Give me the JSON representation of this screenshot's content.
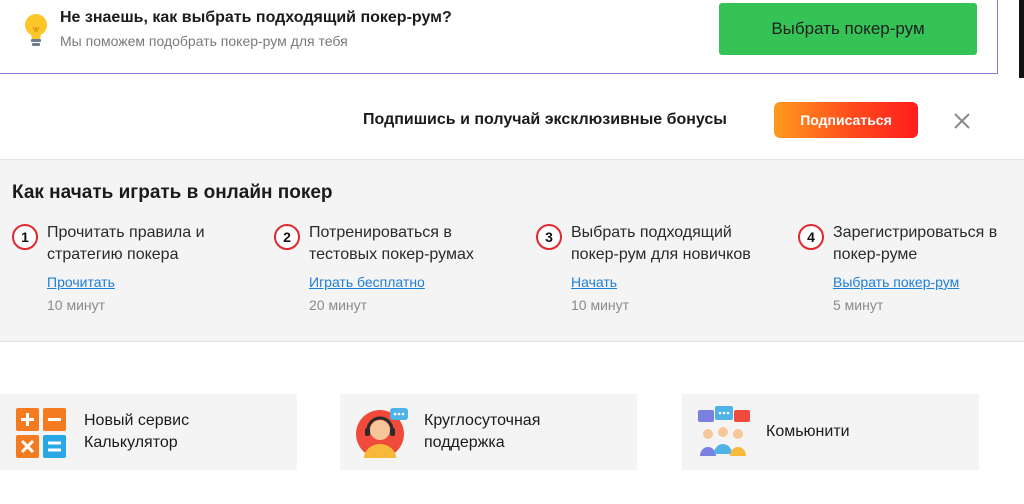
{
  "top_banner": {
    "title": "Не знаешь, как выбрать подходящий покер-рум?",
    "subtitle": "Мы поможем подобрать покер-рум для тебя",
    "button": "Выбрать покер-рум",
    "icon": "lightbulb-icon"
  },
  "subscribe": {
    "text": "Подпишись и получай эксклюзивные бонусы",
    "button": "Подписаться",
    "close_icon": "close-icon"
  },
  "steps_section": {
    "title": "Как начать играть в онлайн покер",
    "steps": [
      {
        "num": "1",
        "line1": "Прочитать правила и",
        "line2": "стратегию покера",
        "link": "Прочитать",
        "time": "10 минут"
      },
      {
        "num": "2",
        "line1": "Потренироваться в",
        "line2": "тестовых покер-румах",
        "link": "Играть бесплатно",
        "time": "20 минут"
      },
      {
        "num": "3",
        "line1": "Выбрать подходящий",
        "line2": "покер-рум для новичков",
        "link": "Начать",
        "time": "10 минут"
      },
      {
        "num": "4",
        "line1": "Зарегистрироваться в",
        "line2": "покер-руме",
        "link": "Выбрать покер-рум",
        "time": "5 минут"
      }
    ]
  },
  "cards": [
    {
      "line1": "Новый сервис",
      "line2": "Калькулятор",
      "icon": "calculator-icon"
    },
    {
      "line1": "Круглосуточная",
      "line2": "поддержка",
      "icon": "support-agent-icon"
    },
    {
      "line1": "Комьюнити",
      "line2": "",
      "icon": "community-icon"
    }
  ],
  "colors": {
    "green_button": "#35c356",
    "subscribe_gradient_start": "#ff9a1f",
    "subscribe_gradient_end": "#ff1d1d",
    "step_circle": "#e0282e",
    "link": "#1e7fd6"
  }
}
